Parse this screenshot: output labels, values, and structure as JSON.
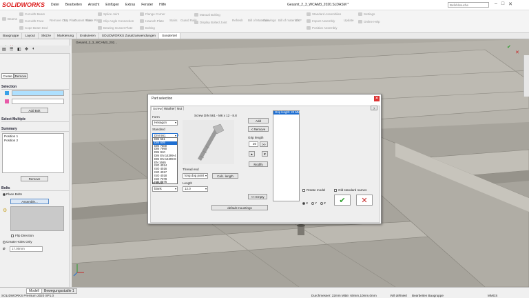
{
  "app": {
    "logo_text": "SOLIDWORKS",
    "doc_title": "Gesamt_2_3_WCAM3_2020.SLDASM *",
    "search_placeholder": "Befehlssuche"
  },
  "menu": [
    "Datei",
    "Bearbeiten",
    "Ansicht",
    "Einfügen",
    "Extras",
    "Fenster",
    "Hilfe"
  ],
  "ribbon": {
    "left": [
      "Beams",
      "Cut with Beam",
      "Cut with Face",
      "Cope Beam End",
      "Remove Cut",
      "Top Plate",
      "Gusset Plate",
      "Base Plate",
      "Splice Joint",
      "Clip Angle Connection",
      "Bearing Gusset Plate",
      "Flange Corner",
      "Haunch Plate",
      "Bolting",
      "Stairs",
      "Guard Rails",
      "Manual Bolting",
      "Display Bolted Joint"
    ],
    "right": [
      "Refresh",
      "Bill of Materials",
      "Drawings",
      "Bill of materials",
      "DXF",
      "Standard Assemblies",
      "Import Assembly",
      "Position Assembly",
      "Update",
      "Settings",
      "Online Help"
    ]
  },
  "tabs": [
    "Baugruppe",
    "Layout",
    "Skizze",
    "Markierung",
    "Evaluieren",
    "SOLIDWORKS Zusatzanwendungen",
    "Sonderteil"
  ],
  "active_tab": "Sonderteil",
  "tree_item": "Gesamt_2_3_WCAM3_202...",
  "left_panel": {
    "create_tab": "Create",
    "remove_tab": "Remove",
    "selection_title": "Selection",
    "add_bolt": "Add Bolt",
    "select_multiple": "Select Multiple",
    "summary_title": "Summary",
    "summary_items": [
      "Position 1",
      "Position 2"
    ],
    "remove_btn": "Remove",
    "bolts_title": "Bolts",
    "place_bolts": "Place Bolts",
    "assembly_btn": "Assemble...",
    "flip_direction": "Flip Direction",
    "create_holes": "Create Holes Only",
    "hole_value": "17.00mm"
  },
  "dialog": {
    "title": "Part selection",
    "tabs": [
      "Screw",
      "Washer",
      "Nut"
    ],
    "form_label": "Form",
    "form_value": "Hexagon",
    "standard_label": "Standard",
    "standard_value": "DIN 561",
    "standard_options": [
      "DIN 561",
      "DIN 609",
      "DIN 7500",
      "DIN 7990",
      "DIN 910",
      "DIN EN 14399-4",
      "DIN EN 14399-8",
      "EN 1665",
      "ISO 4014",
      "ISO 4016",
      "ISO 4017",
      "ISO 4018",
      "ISO 7378",
      "ISO 8676"
    ],
    "standard_highlight": "DIN 609",
    "surface_label": "Surface",
    "surface_value": "blank",
    "part_name": "Screw DIN 561 - M6 x 12 - 8.8",
    "thread_end_label": "Thread end",
    "thread_end_value": "long dog point",
    "calc_length": "Calc. length",
    "length_label": "Length",
    "length_value": "12.0",
    "add": "Add",
    "remove": "< Remove",
    "grip_label": "Grip length",
    "grip_value": "20",
    "grip_btn": ">>",
    "up": "▲",
    "down": "▼",
    "modify": "Modify",
    "empty": "<< Empty",
    "default_mountings": "default mountings",
    "grip_list_item": "Grip length: 20 MM",
    "help_btn": "?",
    "rotate_model": "Rotate model",
    "old_names": "Old standard names",
    "axis_x": "X",
    "axis_y": "Y",
    "axis_z": "Z",
    "ok_icon": "check-icon",
    "cancel_icon": "x-icon"
  },
  "statusbar": {
    "tabs": [
      "Modell",
      "Bewegungsstudie 1"
    ],
    "left": "SOLIDWORKS Premium 2020 SP1.0",
    "measure": "Durchmesser: 22mm  Mitte: 60mm,10mm,0mm",
    "defined": "Voll definiert",
    "mode": "Bearbeiten Baugruppe",
    "units": "MMGS"
  },
  "colors": {
    "accent": "#1f6fd1",
    "ok": "#2a9d2a",
    "cancel": "#c62828",
    "bg3d": "#adaaa2"
  }
}
